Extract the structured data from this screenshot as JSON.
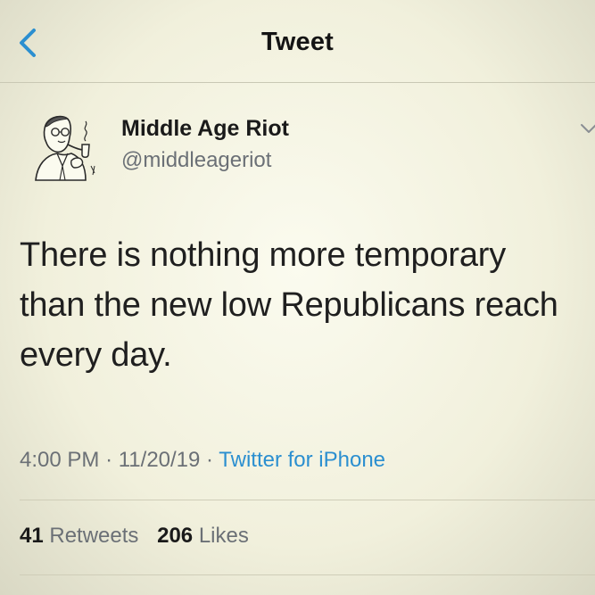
{
  "header": {
    "title": "Tweet",
    "back_icon": "chevron-left-icon"
  },
  "author": {
    "name": "Middle Age Riot",
    "handle": "@middleageriot",
    "avatar_icon": "pipe-smoking-man-illustration"
  },
  "tweet": {
    "text_lines": [
      "There is nothing more temporary",
      "than the new low Republicans reach",
      "every day."
    ]
  },
  "meta": {
    "time": "4:00 PM",
    "sep1": "·",
    "date": "11/20/19",
    "sep2": "·",
    "source": "Twitter for iPhone"
  },
  "stats": {
    "retweets_count": "41",
    "retweets_label": "Retweets",
    "likes_count": "206",
    "likes_label": "Likes"
  },
  "colors": {
    "accent": "#2b8fd0",
    "secondary_text": "#6b7076"
  }
}
